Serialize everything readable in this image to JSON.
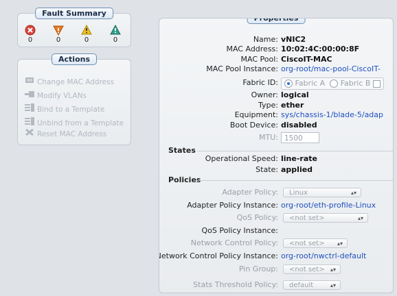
{
  "fault_summary": {
    "title": "Fault Summary",
    "faults": [
      {
        "icon": "critical-icon",
        "count": "0",
        "color": "#d9453b"
      },
      {
        "icon": "major-icon",
        "count": "0",
        "color": "#e97a20"
      },
      {
        "icon": "minor-icon",
        "count": "0",
        "color": "#f1c21b"
      },
      {
        "icon": "warning-icon",
        "count": "0",
        "color": "#2f9e8a"
      }
    ]
  },
  "actions": {
    "title": "Actions",
    "items": [
      {
        "label": "Change MAC Address",
        "icon": "change-mac-icon"
      },
      {
        "label": "Modify VLANs",
        "icon": "modify-vlans-icon"
      },
      {
        "label": "Bind to a Template",
        "icon": "bind-template-icon"
      },
      {
        "label": "Unbind from a Template",
        "icon": "unbind-template-icon"
      },
      {
        "label": "Reset MAC Address",
        "icon": "reset-mac-icon"
      }
    ]
  },
  "properties": {
    "title": "Properties",
    "name_label": "Name:",
    "name": "vNIC2",
    "mac_label": "MAC Address:",
    "mac": "10:02:4C:00:00:8F",
    "mac_pool_label": "MAC Pool:",
    "mac_pool": "CiscoIT-MAC",
    "mac_pool_instance_label": "MAC Pool Instance:",
    "mac_pool_instance": "org-root/mac-pool-CiscoIT-",
    "fabric_label": "Fabric ID:",
    "fabric_a": "Fabric A",
    "fabric_b": "Fabric B",
    "owner_label": "Owner:",
    "owner": "logical",
    "type_label": "Type:",
    "type": "ether",
    "equipment_label": "Equipment:",
    "equipment": "sys/chassis-1/blade-5/adap",
    "boot_label": "Boot Device:",
    "boot": "disabled",
    "mtu_label": "MTU:",
    "mtu": "1500"
  },
  "states": {
    "title": "States",
    "speed_label": "Operational Speed:",
    "speed": "line-rate",
    "state_label": "State:",
    "state": "applied"
  },
  "policies": {
    "title": "Policies",
    "adapter_label": "Adapter Policy:",
    "adapter": "Linux",
    "adapter_instance_label": "Adapter Policy Instance:",
    "adapter_instance": "org-root/eth-profile-Linux",
    "qos_label": "QoS Policy:",
    "qos": "<not set>",
    "qos_instance_label": "QoS Policy Instance:",
    "netctrl_label": "Network Control Policy:",
    "netctrl": "<not set>",
    "netctrl_instance_label": "Network Control Policy Instance:",
    "netctrl_instance": "org-root/nwctrl-default",
    "pin_label": "Pin Group:",
    "pin": "<not set>",
    "stats_label": "Stats Threshold Policy:",
    "stats": "default"
  }
}
